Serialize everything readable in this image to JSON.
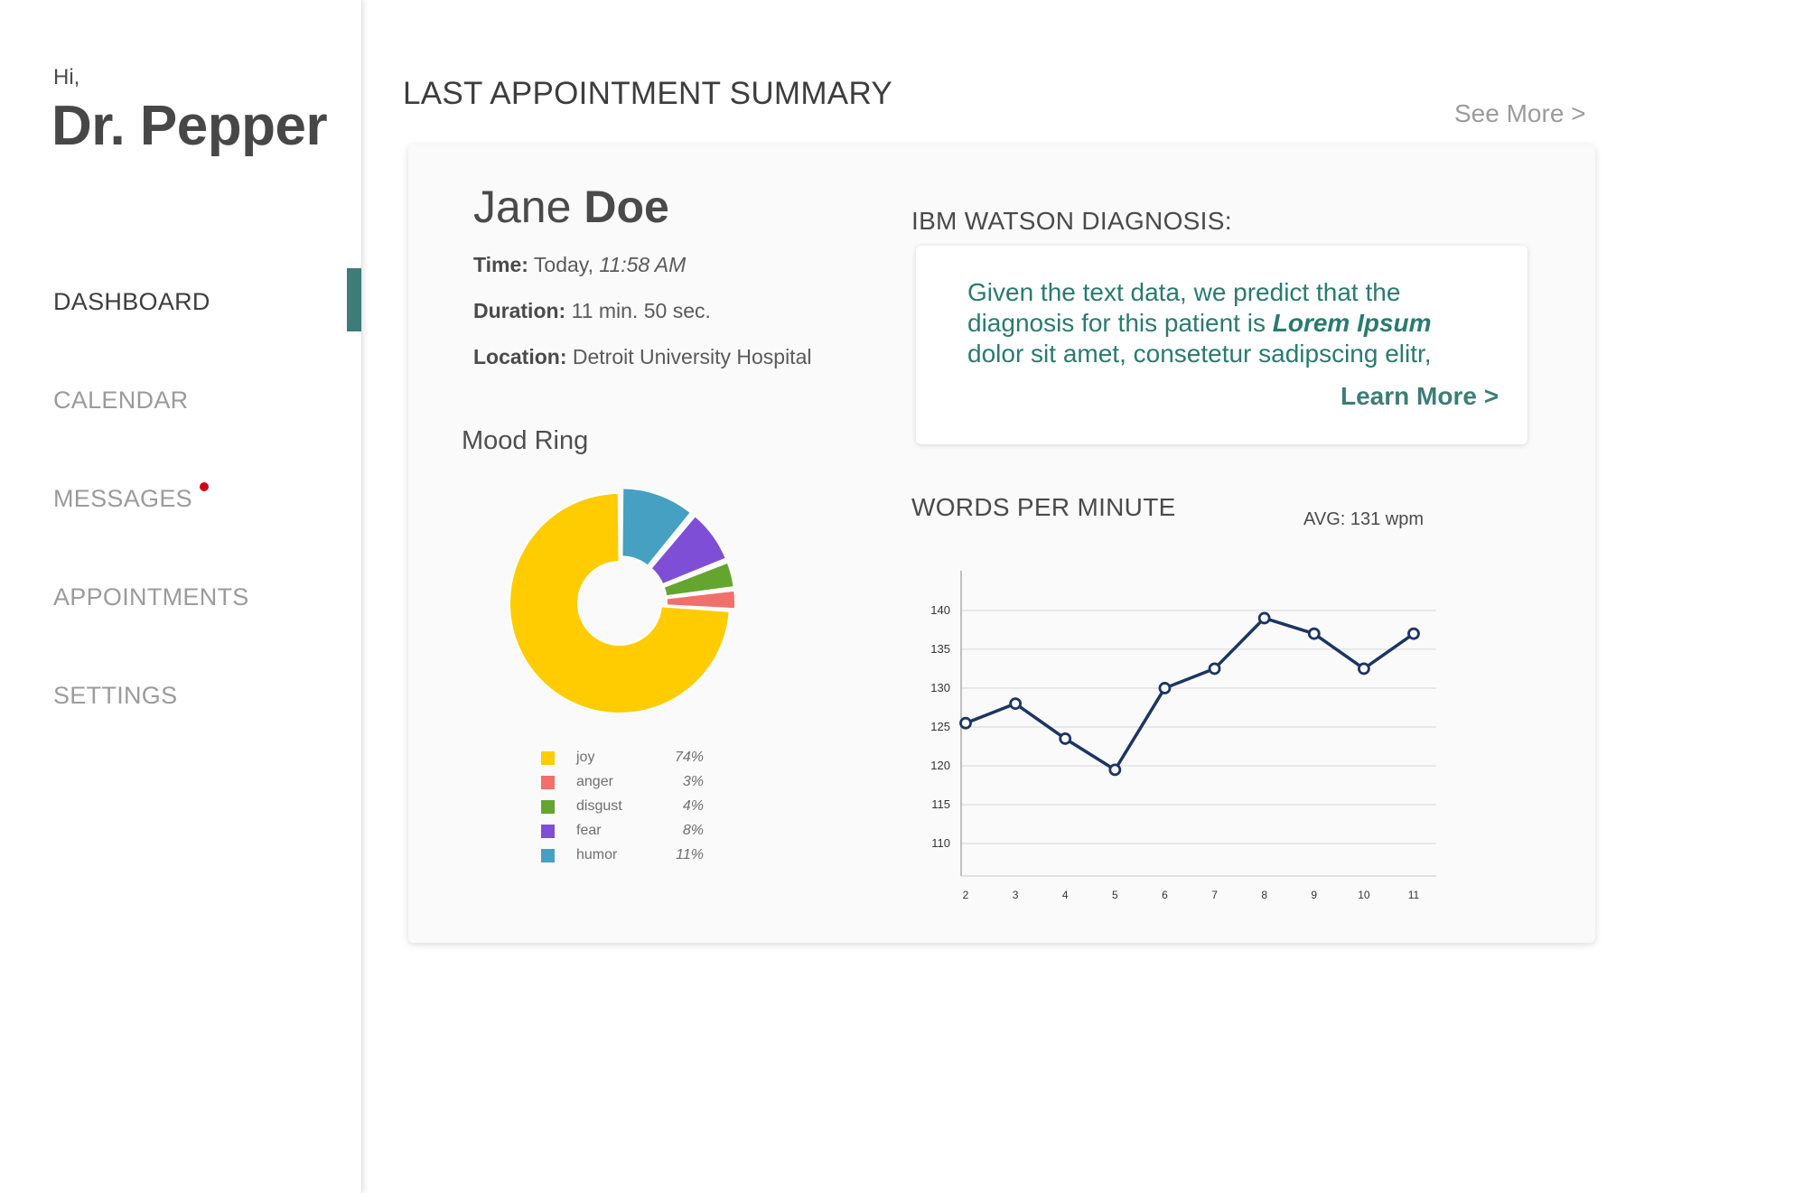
{
  "sidebar": {
    "greeting": "Hi,",
    "user_name": "Dr. Pepper",
    "items": [
      {
        "label": "DASHBOARD",
        "active": true
      },
      {
        "label": "CALENDAR",
        "active": false
      },
      {
        "label": "MESSAGES",
        "active": false,
        "has_notification": true
      },
      {
        "label": "APPOINTMENTS",
        "active": false
      },
      {
        "label": "SETTINGS",
        "active": false
      }
    ],
    "accent_color": "#3d7d78",
    "notification_color": "#d0021b"
  },
  "main": {
    "title": "LAST APPOINTMENT SUMMARY",
    "see_more": "See More >"
  },
  "patient": {
    "first_name": "Jane",
    "last_name": "Doe",
    "time_label": "Time:",
    "time_day": "Today,",
    "time_value": "11:58 AM",
    "duration_label": "Duration:",
    "duration_value": "11 min. 50 sec.",
    "location_label": "Location:",
    "location_value": "Detroit University Hospital"
  },
  "diagnosis": {
    "title": "IBM WATSON DIAGNOSIS:",
    "text_before": "Given the text data, we predict that the diagnosis for this patient is",
    "highlight": "Lorem Ipsum",
    "text_after": "dolor sit amet, consetetur sadipscing elitr,",
    "learn_more": "Learn More >",
    "text_color": "#2a7a6f"
  },
  "mood": {
    "title": "Mood Ring"
  },
  "wpm": {
    "title": "WORDS PER MINUTE",
    "avg_label": "AVG: 131 wpm"
  },
  "chart_data": [
    {
      "type": "pie",
      "title": "Mood Ring",
      "donut": true,
      "slices": [
        {
          "label": "joy",
          "value": 74,
          "pct_label": "74%",
          "color": "#fecc00"
        },
        {
          "label": "anger",
          "value": 3,
          "pct_label": "3%",
          "color": "#f0716b"
        },
        {
          "label": "disgust",
          "value": 4,
          "pct_label": "4%",
          "color": "#64a530"
        },
        {
          "label": "fear",
          "value": 8,
          "pct_label": "8%",
          "color": "#7e4fd6"
        },
        {
          "label": "humor",
          "value": 11,
          "pct_label": "11%",
          "color": "#45a0c2"
        }
      ],
      "legend_order": [
        "joy",
        "anger",
        "disgust",
        "fear",
        "humor"
      ]
    },
    {
      "type": "line",
      "title": "WORDS PER MINUTE",
      "x": [
        2,
        3,
        4,
        5,
        6,
        7,
        8,
        9,
        10,
        11
      ],
      "series": [
        {
          "values": [
            125.5,
            128,
            123.5,
            119.5,
            130,
            132.5,
            139,
            137,
            132.5,
            137
          ],
          "color": "#1c3563"
        }
      ],
      "yticks": [
        110,
        115,
        120,
        125,
        130,
        135,
        140
      ],
      "xticks": [
        2,
        3,
        4,
        5,
        6,
        7,
        8,
        9,
        10,
        11
      ],
      "ylim": [
        107,
        143
      ],
      "grid": true,
      "xlabel": "",
      "ylabel": ""
    }
  ]
}
